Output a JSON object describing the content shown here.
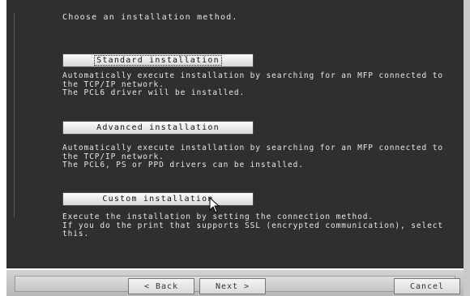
{
  "prompt": "Choose an installation method.",
  "options": [
    {
      "label": "Standard installation",
      "description": "Automatically execute installation by searching for an MFP connected to\nthe TCP/IP network.\nThe PCL6 driver will be installed."
    },
    {
      "label": "Advanced installation",
      "description": "Automatically execute installation by searching for an MFP connected to\nthe TCP/IP network.\nThe PCL6, PS or PPD drivers can be installed."
    },
    {
      "label": "Custom installation",
      "description": "Execute the installation by setting the connection method.\nIf you do the print that supports SSL (encrypted communication), select\nthis."
    }
  ],
  "footer": {
    "back_label": "< Back",
    "next_label": "Next >",
    "cancel_label": "Cancel"
  },
  "colors": {
    "background": "#2f2f2f",
    "text": "#e6e6e6",
    "frame": "#c9c9c9"
  }
}
